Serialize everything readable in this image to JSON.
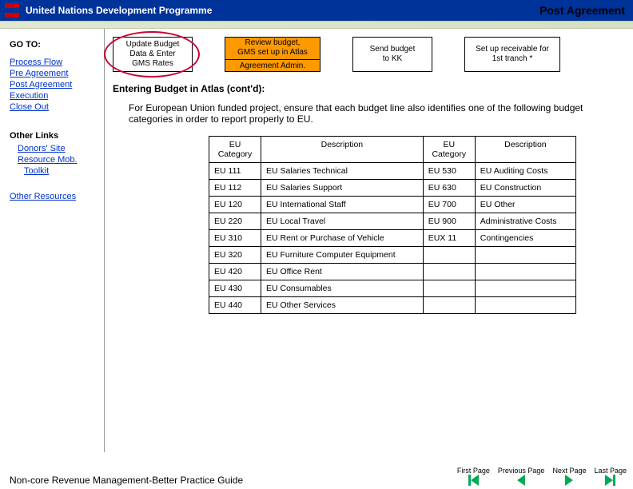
{
  "header": {
    "org": "United Nations Development Programme",
    "title": "Post Agreement"
  },
  "sidebar": {
    "goto_label": "GO TO:",
    "nav": [
      "Process Flow",
      "Pre Agreement",
      "Post Agreement",
      "Execution",
      "Close Out"
    ],
    "other_links_label": "Other Links",
    "other_links": [
      "Donors' Site",
      "Resource Mob.",
      "Toolkit"
    ],
    "other_resources": "Other Resources"
  },
  "flow": {
    "box1_l1": "Update Budget",
    "box1_l2": "Data & Enter",
    "box1_l3": "GMS Rates",
    "box2_l1": "Review budget,",
    "box2_l2": "GMS set up in Atlas",
    "box2_l3": "Agreement Admin.",
    "box3_l1": "Send budget",
    "box3_l2": "to KK",
    "box4_l1": "Set up receivable for",
    "box4_l2": "1st tranch *"
  },
  "section": {
    "title": "Entering Budget in Atlas (cont'd):",
    "body": "For European Union funded project, ensure that each budget line also identifies one of the following budget categories in order to report properly to EU."
  },
  "table": {
    "h1": "EU Category",
    "h2": "Description",
    "h3": "EU Category",
    "h4": "Description",
    "rows": [
      {
        "c1": "EU 111",
        "c2": "EU Salaries Technical",
        "c3": "EU 530",
        "c4": "EU Auditing Costs"
      },
      {
        "c1": "EU 112",
        "c2": "EU Salaries Support",
        "c3": "EU 630",
        "c4": "EU Construction"
      },
      {
        "c1": "EU 120",
        "c2": "EU International Staff",
        "c3": "EU 700",
        "c4": "EU Other"
      },
      {
        "c1": "EU 220",
        "c2": "EU Local Travel",
        "c3": "EU 900",
        "c4": "Administrative Costs"
      },
      {
        "c1": "EU 310",
        "c2": "EU Rent or Purchase of Vehicle",
        "c3": "EUX 11",
        "c4": "Contingencies"
      },
      {
        "c1": "EU 320",
        "c2": "EU Furniture Computer Equipment",
        "c3": "",
        "c4": ""
      },
      {
        "c1": "EU 420",
        "c2": "EU Office Rent",
        "c3": "",
        "c4": ""
      },
      {
        "c1": "EU 430",
        "c2": "EU Consumables",
        "c3": "",
        "c4": ""
      },
      {
        "c1": "EU 440",
        "c2": "EU Other Services",
        "c3": "",
        "c4": ""
      }
    ]
  },
  "footer": {
    "title": "Non-core Revenue Management-Better Practice Guide",
    "pager": {
      "first": "First Page",
      "prev": "Previous Page",
      "next": "Next Page",
      "last": "Last Page"
    }
  }
}
